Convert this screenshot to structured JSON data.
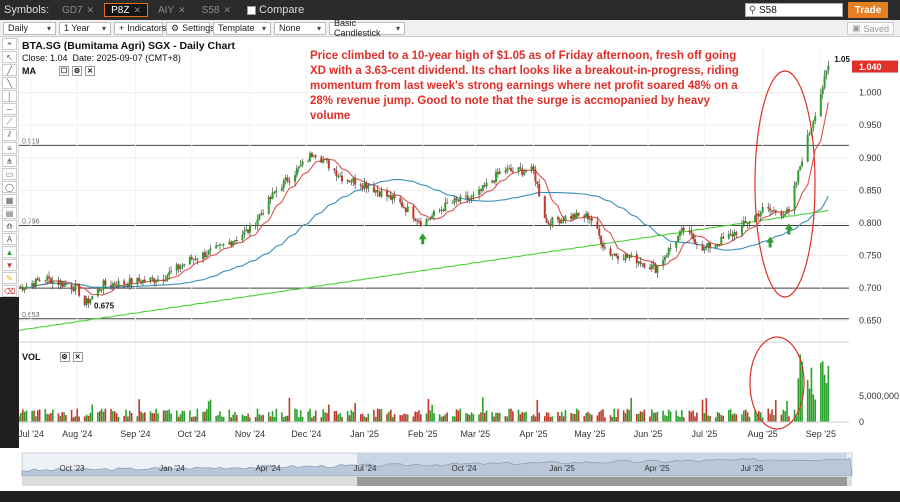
{
  "symbols_bar": {
    "label": "Symbols:",
    "tabs": [
      {
        "label": "GD7",
        "active": false
      },
      {
        "label": "P8Z",
        "active": true
      },
      {
        "label": "AIY",
        "active": false
      },
      {
        "label": "S58",
        "active": false
      }
    ],
    "compare_label": "Compare",
    "search_value": "S58",
    "trade_label": "Trade"
  },
  "toolbar": {
    "interval": "Daily",
    "range": "1 Year",
    "indicators_label": "Indicators",
    "settings_label": "Settings",
    "template": "Template",
    "none": "None",
    "chart_style": "Basic Candlestick",
    "saved_label": "Saved"
  },
  "chart": {
    "title": "BTA.SG (Bumitama Agri) SGX - Daily Chart",
    "close_label": "Close: 1.04",
    "date_label": "Date: 2025-09-07 (CMT+8)",
    "ma_label": "MA",
    "vol_label": "VOL",
    "annotation": "Price climbed to a 10-year high of $1.05 as of Friday afternoon, fresh off going XD with a 3.63-cent dividend. Its chart looks like a breakout-in-progress, riding momentum from last week's strong earnings where net profit soared 48% on a 28% revenue jump. Good to note that the surge is accmopanied by heavy volume",
    "hline_labels": [
      "0.919",
      "0.796",
      "0.653"
    ],
    "peak_label": "1.05",
    "low_label": "0.675",
    "current_price": "1.040",
    "accent": "#e0302a",
    "up_color": "#2ca02c",
    "down_color": "#c0392b",
    "ma_short_color": "#d9534f",
    "ma_mid_color": "#3a8fb7",
    "ma_long_color": "#4cd137"
  },
  "chart_data": {
    "type": "line",
    "y_ticks": [
      "1.040",
      "1.000",
      "0.950",
      "0.900",
      "0.850",
      "0.800",
      "0.750",
      "0.700",
      "0.650"
    ],
    "x_ticks": [
      "Jul '24",
      "Aug '24",
      "Sep '24",
      "Oct '24",
      "Nov '24",
      "Dec '24",
      "Jan '25",
      "Feb '25",
      "Mar '25",
      "Apr '25",
      "May '25",
      "Jun '25",
      "Jul '25",
      "Aug '25",
      "Sep '25"
    ],
    "vol_ticks": [
      "5,000,000",
      "0"
    ],
    "ylim": [
      0.625,
      1.07
    ],
    "price_series": [
      [
        "2024-07-01",
        0.7
      ],
      [
        "2024-07-15",
        0.715
      ],
      [
        "2024-08-01",
        0.7
      ],
      [
        "2024-08-05",
        0.675
      ],
      [
        "2024-08-15",
        0.705
      ],
      [
        "2024-09-01",
        0.71
      ],
      [
        "2024-09-15",
        0.715
      ],
      [
        "2024-10-01",
        0.745
      ],
      [
        "2024-10-15",
        0.76
      ],
      [
        "2024-11-01",
        0.79
      ],
      [
        "2024-11-15",
        0.85
      ],
      [
        "2024-12-01",
        0.895
      ],
      [
        "2024-12-05",
        0.91
      ],
      [
        "2024-12-20",
        0.87
      ],
      [
        "2025-01-01",
        0.86
      ],
      [
        "2025-01-20",
        0.83
      ],
      [
        "2025-02-01",
        0.8
      ],
      [
        "2025-02-15",
        0.83
      ],
      [
        "2025-03-01",
        0.84
      ],
      [
        "2025-03-15",
        0.88
      ],
      [
        "2025-04-01",
        0.88
      ],
      [
        "2025-04-08",
        0.8
      ],
      [
        "2025-04-20",
        0.81
      ],
      [
        "2025-05-01",
        0.81
      ],
      [
        "2025-05-10",
        0.755
      ],
      [
        "2025-05-25",
        0.745
      ],
      [
        "2025-06-05",
        0.73
      ],
      [
        "2025-06-20",
        0.79
      ],
      [
        "2025-07-01",
        0.76
      ],
      [
        "2025-07-15",
        0.78
      ],
      [
        "2025-08-01",
        0.82
      ],
      [
        "2025-08-15",
        0.815
      ],
      [
        "2025-08-22",
        0.9
      ],
      [
        "2025-08-29",
        0.97
      ],
      [
        "2025-09-05",
        1.04
      ]
    ],
    "date_range": [
      "2024-07-01",
      "2025-09-16"
    ],
    "nav_ticks": [
      "Oct '23",
      "Jan '24",
      "Apr '24",
      "Jul '24",
      "Oct '24",
      "Jan '25",
      "Apr '25",
      "Jul '25"
    ]
  }
}
